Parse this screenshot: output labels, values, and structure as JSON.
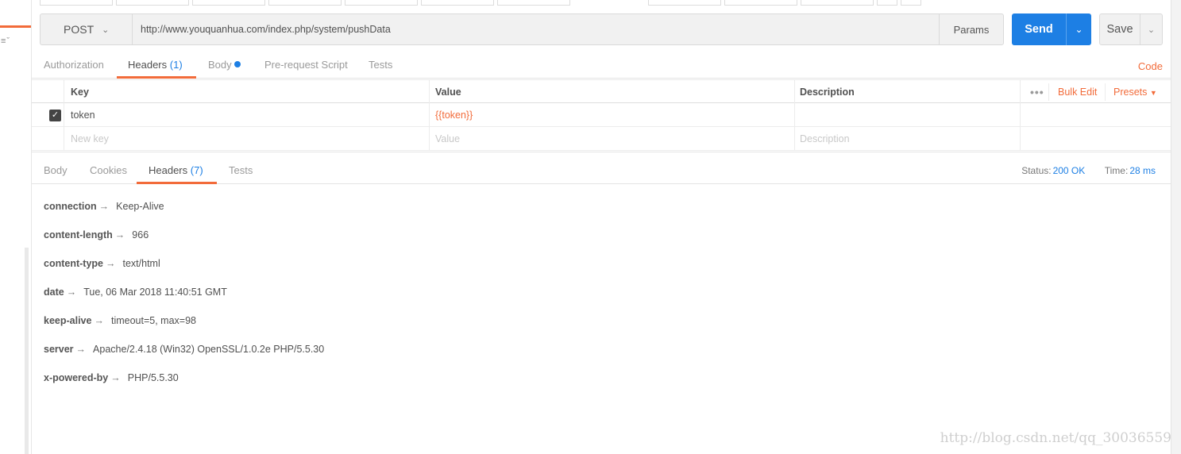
{
  "sidebar": {
    "sort_icon": "sort-icon"
  },
  "request": {
    "method": "POST",
    "url": "http://www.youquanhua.com/index.php/system/pushData",
    "params_label": "Params",
    "send_label": "Send",
    "save_label": "Save"
  },
  "request_tabs": {
    "authorization": "Authorization",
    "headers": "Headers",
    "headers_count": "(1)",
    "body": "Body",
    "prerequest": "Pre-request Script",
    "tests": "Tests",
    "code": "Code"
  },
  "headers_table": {
    "col_key": "Key",
    "col_value": "Value",
    "col_description": "Description",
    "more": "•••",
    "bulk_edit": "Bulk Edit",
    "presets": "Presets",
    "rows": [
      {
        "checked": true,
        "key": "token",
        "value": "{{token}}",
        "description": ""
      }
    ],
    "new_key_placeholder": "New key",
    "new_value_placeholder": "Value",
    "new_description_placeholder": "Description"
  },
  "response_tabs": {
    "body": "Body",
    "cookies": "Cookies",
    "headers": "Headers",
    "headers_count": "(7)",
    "tests": "Tests",
    "status_label": "Status:",
    "status_value": "200 OK",
    "time_label": "Time:",
    "time_value": "28 ms"
  },
  "response_headers": [
    {
      "key": "connection",
      "value": "Keep-Alive"
    },
    {
      "key": "content-length",
      "value": "966"
    },
    {
      "key": "content-type",
      "value": "text/html"
    },
    {
      "key": "date",
      "value": "Tue, 06 Mar 2018 11:40:51 GMT"
    },
    {
      "key": "keep-alive",
      "value": "timeout=5, max=98"
    },
    {
      "key": "server",
      "value": "Apache/2.4.18 (Win32) OpenSSL/1.0.2e PHP/5.5.30"
    },
    {
      "key": "x-powered-by",
      "value": "PHP/5.5.30"
    }
  ],
  "arrow": "→",
  "watermark": "http://blog.csdn.net/qq_30036559",
  "colors": {
    "accent": "#f26b3a",
    "primary": "#1d7fe4"
  }
}
